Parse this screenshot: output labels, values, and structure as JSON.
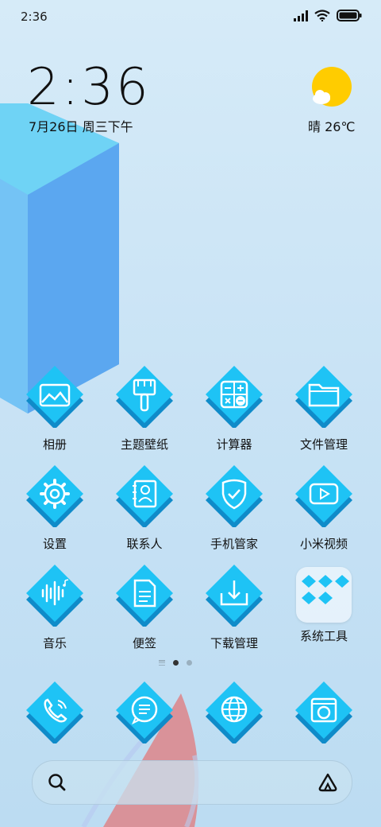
{
  "status": {
    "time": "2:36"
  },
  "clock": {
    "time": "2:36",
    "date": "7月26日 周三下午"
  },
  "weather": {
    "text": "晴 26℃",
    "icon": "sunny-cloud-icon"
  },
  "apps": [
    {
      "label": "相册",
      "icon": "gallery-icon"
    },
    {
      "label": "主题壁纸",
      "icon": "brush-icon"
    },
    {
      "label": "计算器",
      "icon": "calculator-icon"
    },
    {
      "label": "文件管理",
      "icon": "folder-icon"
    },
    {
      "label": "设置",
      "icon": "gear-icon"
    },
    {
      "label": "联系人",
      "icon": "contacts-icon"
    },
    {
      "label": "手机管家",
      "icon": "shield-icon"
    },
    {
      "label": "小米视频",
      "icon": "play-icon"
    },
    {
      "label": "音乐",
      "icon": "music-wave-icon"
    },
    {
      "label": "便签",
      "icon": "note-icon"
    },
    {
      "label": "下载管理",
      "icon": "download-icon"
    },
    {
      "label": "系统工具",
      "icon": "folder-group-icon"
    }
  ],
  "dock": [
    {
      "icon": "phone-icon"
    },
    {
      "icon": "message-icon"
    },
    {
      "icon": "browser-icon"
    },
    {
      "icon": "camera-icon"
    }
  ],
  "colors": {
    "tile_top": "#1ec3f5",
    "tile_side": "#129fdc",
    "tile_shadow": "#0f8bc9",
    "sun": "#ffcc00"
  }
}
